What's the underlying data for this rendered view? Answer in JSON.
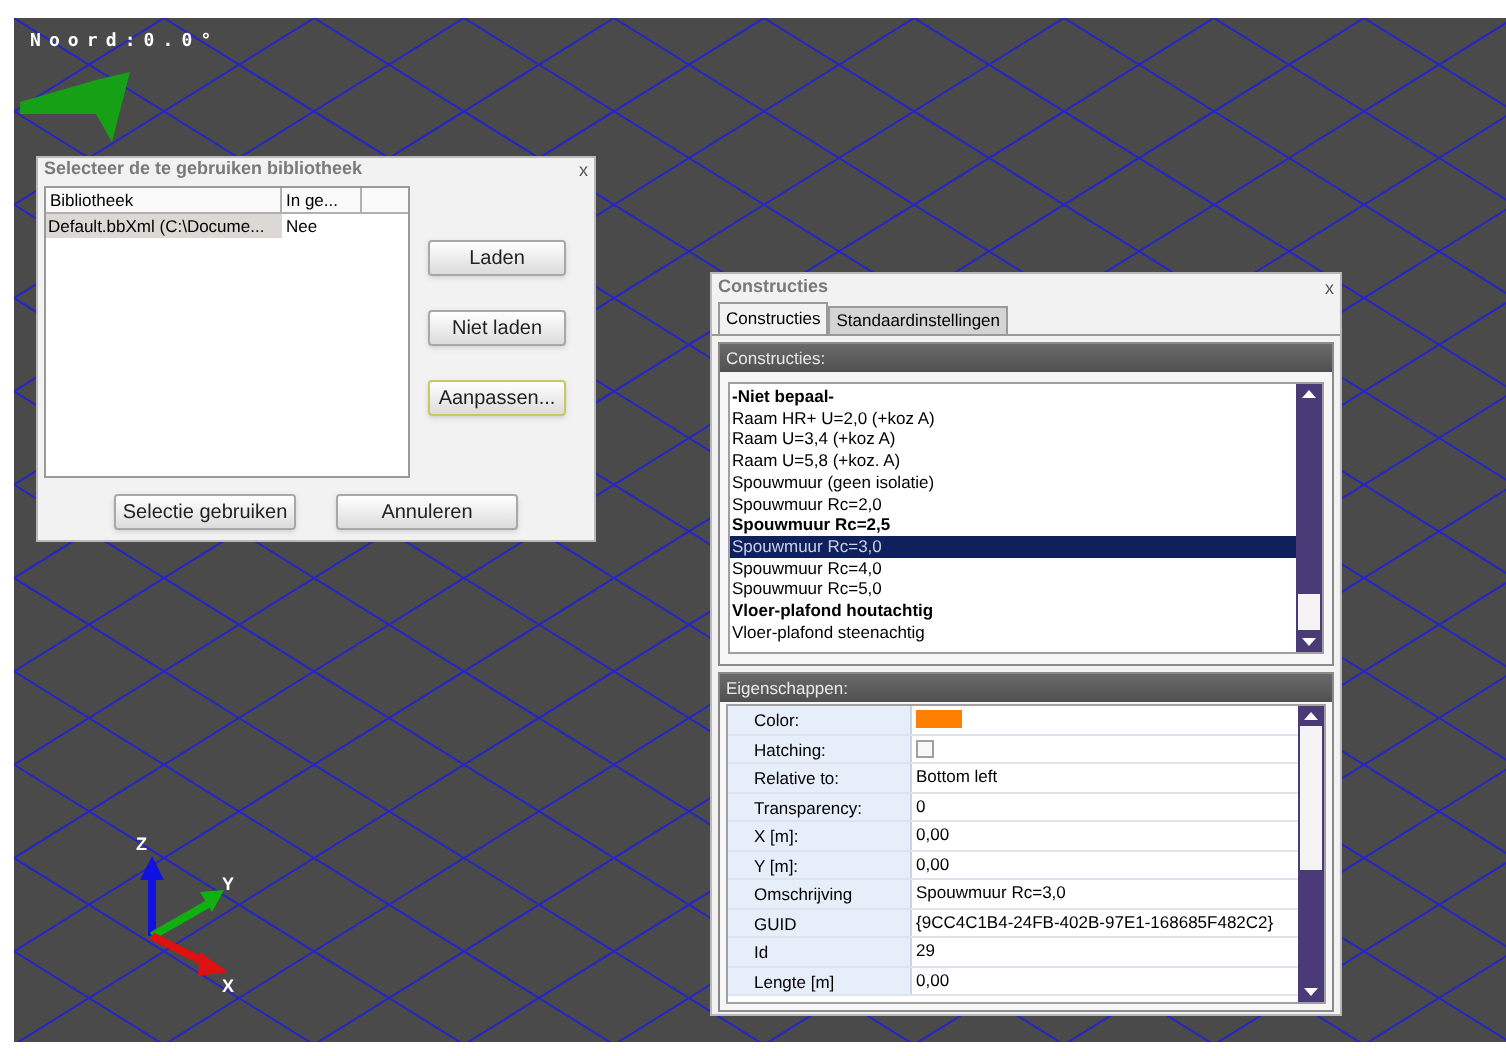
{
  "viewport": {
    "compass": "Noord:0.0°",
    "axes": [
      {
        "kind": "z",
        "label": "Z"
      },
      {
        "kind": "y",
        "label": "Y"
      },
      {
        "kind": "x",
        "label": "X"
      }
    ]
  },
  "library_dialog": {
    "title": "Selecteer de te gebruiken bibliotheek",
    "close": "x",
    "columns": [
      "Bibliotheek",
      "In ge..."
    ],
    "rows": [
      {
        "cells": [
          "Default.bbXml (C:\\Docume...",
          "Nee"
        ],
        "selected": true
      }
    ],
    "side_buttons": [
      {
        "label": "Laden",
        "focused": false
      },
      {
        "label": "Niet laden",
        "focused": false
      },
      {
        "label": "Aanpassen...",
        "focused": true
      }
    ],
    "bottom_buttons": [
      "Selectie gebruiken",
      "Annuleren"
    ]
  },
  "constructions_panel": {
    "title": "Constructies",
    "close": "x",
    "tabs": [
      {
        "label": "Constructies",
        "selected": true
      },
      {
        "label": "Standaardinstellingen",
        "selected": false
      }
    ],
    "list_header": "Constructies:",
    "items": [
      {
        "label": "-Niet bepaal-",
        "bold": true,
        "selected": false
      },
      {
        "label": "Raam HR+ U=2,0 (+koz A)",
        "bold": false,
        "selected": false
      },
      {
        "label": "Raam U=3,4 (+koz A)",
        "bold": false,
        "selected": false
      },
      {
        "label": "Raam U=5,8 (+koz. A)",
        "bold": false,
        "selected": false
      },
      {
        "label": "Spouwmuur (geen isolatie)",
        "bold": false,
        "selected": false
      },
      {
        "label": "Spouwmuur Rc=2,0",
        "bold": false,
        "selected": false
      },
      {
        "label": "Spouwmuur Rc=2,5",
        "bold": true,
        "selected": false
      },
      {
        "label": "Spouwmuur Rc=3,0",
        "bold": false,
        "selected": true
      },
      {
        "label": "Spouwmuur Rc=4,0",
        "bold": false,
        "selected": false
      },
      {
        "label": "Spouwmuur Rc=5,0",
        "bold": false,
        "selected": false
      },
      {
        "label": "Vloer-plafond houtachtig",
        "bold": true,
        "selected": false
      },
      {
        "label": "Vloer-plafond steenachtig",
        "bold": false,
        "selected": false
      }
    ],
    "properties_header": "Eigenschappen:",
    "properties": [
      {
        "kind": "color",
        "name": "Color:",
        "color": "#ff8000"
      },
      {
        "kind": "checkbox",
        "name": "Hatching:",
        "checked": false
      },
      {
        "kind": "text",
        "name": "Relative to:",
        "value": "Bottom left"
      },
      {
        "kind": "text",
        "name": "Transparency:",
        "value": "0"
      },
      {
        "kind": "text",
        "name": "X [m]:",
        "value": "0,00"
      },
      {
        "kind": "text",
        "name": "Y [m]:",
        "value": "0,00"
      },
      {
        "kind": "text",
        "name": "Omschrijving",
        "value": "Spouwmuur Rc=3,0"
      },
      {
        "kind": "text",
        "name": "GUID",
        "value": "{9CC4C1B4-24FB-402B-97E1-168685F482C2}"
      },
      {
        "kind": "text",
        "name": "Id",
        "value": "29"
      },
      {
        "kind": "text",
        "name": "Lengte [m]",
        "value": "0,00"
      }
    ]
  }
}
